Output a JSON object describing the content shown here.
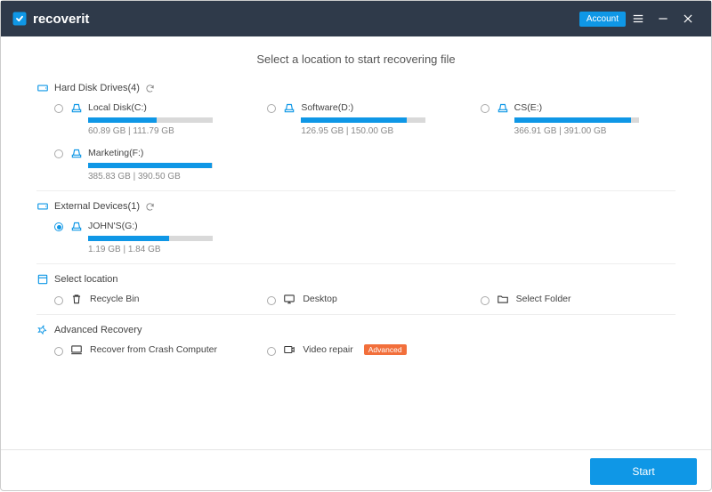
{
  "app": {
    "name": "recoverit"
  },
  "header": {
    "account_label": "Account"
  },
  "page_title": "Select a location to start recovering file",
  "sections": {
    "hdd": {
      "label": "Hard Disk Drives(4)"
    },
    "ext": {
      "label": "External Devices(1)"
    },
    "loc": {
      "label": "Select location"
    },
    "adv": {
      "label": "Advanced Recovery"
    }
  },
  "hdd": [
    {
      "name": "Local Disk(C:)",
      "used": "60.89",
      "total": "111.79",
      "unit": "GB",
      "pct": 55,
      "selected": false
    },
    {
      "name": "Software(D:)",
      "used": "126.95",
      "total": "150.00",
      "unit": "GB",
      "pct": 85,
      "selected": false
    },
    {
      "name": "CS(E:)",
      "used": "366.91",
      "total": "391.00",
      "unit": "GB",
      "pct": 94,
      "selected": false
    },
    {
      "name": "Marketing(F:)",
      "used": "385.83",
      "total": "390.50",
      "unit": "GB",
      "pct": 99,
      "selected": false
    }
  ],
  "ext": [
    {
      "name": "JOHN'S(G:)",
      "used": "1.19",
      "total": "1.84",
      "unit": "GB",
      "pct": 65,
      "selected": true
    }
  ],
  "locations": {
    "recycle": "Recycle Bin",
    "desktop": "Desktop",
    "folder": "Select Folder"
  },
  "advanced": {
    "crash": "Recover from Crash Computer",
    "video": "Video repair",
    "video_badge": "Advanced"
  },
  "footer": {
    "start_label": "Start"
  }
}
